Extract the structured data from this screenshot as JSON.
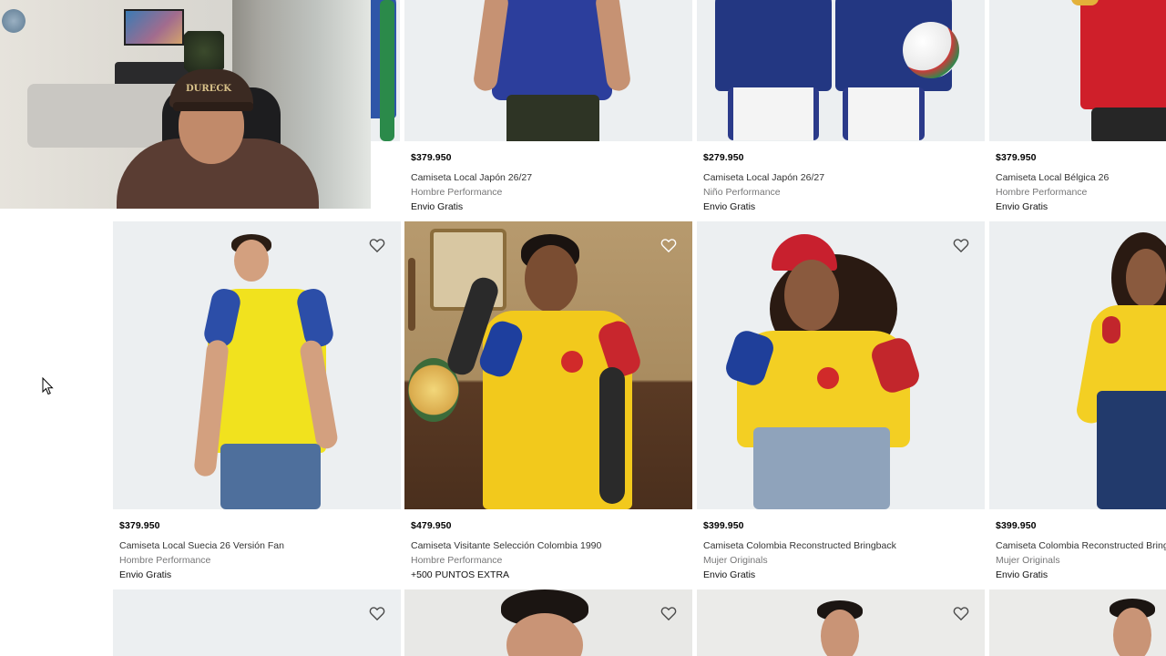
{
  "colors": {
    "image_bg": "#eceff1",
    "price": "#000000",
    "category": "#767677",
    "heart_stroke": "#4a4a4a"
  },
  "products": {
    "row1": [
      {
        "price": "$379.950",
        "name": "Camiseta Local Japón 26/27",
        "category": "Hombre Performance",
        "badge": "Envio Gratis"
      },
      {
        "price": "$279.950",
        "name": "Camiseta Local Japón 26/27",
        "category": "Niño Performance",
        "badge": "Envio Gratis"
      },
      {
        "price": "$379.950",
        "name": "Camiseta Local Bélgica 26",
        "category": "Hombre Performance",
        "badge": "Envio Gratis"
      }
    ],
    "row2": [
      {
        "price": "$379.950",
        "name": "Camiseta Local Suecia 26 Versión Fan",
        "category": "Hombre Performance",
        "badge": "Envio Gratis"
      },
      {
        "price": "$479.950",
        "name": "Camiseta Visitante Selección Colombia 1990",
        "category": "Hombre Performance",
        "badge": "+500 PUNTOS EXTRA"
      },
      {
        "price": "$399.950",
        "name": "Camiseta Colombia Reconstructed Bringback",
        "category": "Mujer Originals",
        "badge": "Envio Gratis"
      },
      {
        "price": "$399.950",
        "name": "Camiseta Colombia Reconstructed Bringback",
        "category": "Mujer Originals",
        "badge": "Envio Gratis"
      }
    ]
  },
  "icons": {
    "wishlist": "heart-outline-icon",
    "cursor": "mouse-pointer-icon"
  },
  "webcam": {
    "cap_text": "DURECK"
  }
}
